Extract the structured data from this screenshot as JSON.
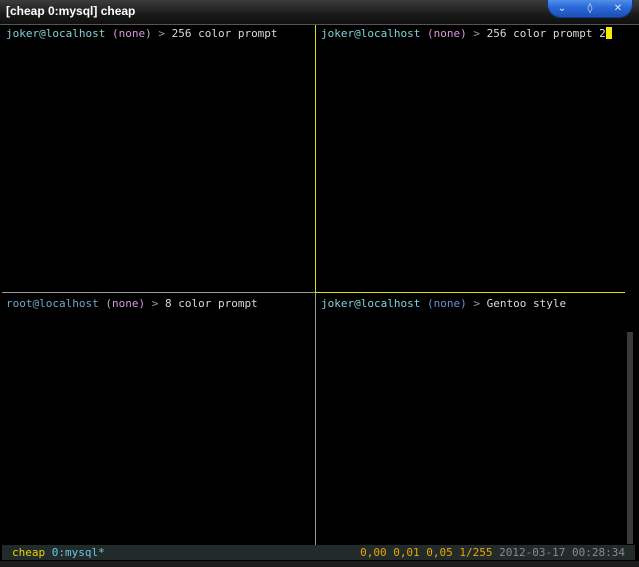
{
  "window": {
    "title": "[cheap 0:mysql] cheap"
  },
  "wm_buttons": {
    "minimize_glyph": "⌄",
    "maximize_glyph": "◊",
    "close_glyph": "✕"
  },
  "panes": {
    "top_left": {
      "user_host": "joker@localhost",
      "tag": "(none)",
      "arrow": ">",
      "command": "256 color prompt"
    },
    "top_right": {
      "user_host": "joker@localhost",
      "tag": "(none)",
      "arrow": ">",
      "command": "256 color prompt 2"
    },
    "bottom_left": {
      "user_host": "root@localhost",
      "tag": "(none)",
      "arrow": ">",
      "command": "8 color prompt"
    },
    "bottom_right": {
      "user_host": "joker@localhost",
      "tag": "(none)",
      "arrow": ">",
      "command": "Gentoo style"
    }
  },
  "statusbar": {
    "session": "cheap",
    "window": "0:mysql*",
    "load": "0,00 0,01 0,05 1/255",
    "datetime": "2012-03-17 00:28:34"
  },
  "colors": {
    "active_border": "#e3e000",
    "inactive_border": "#9a9a9a",
    "cursor": "#f2f000"
  }
}
